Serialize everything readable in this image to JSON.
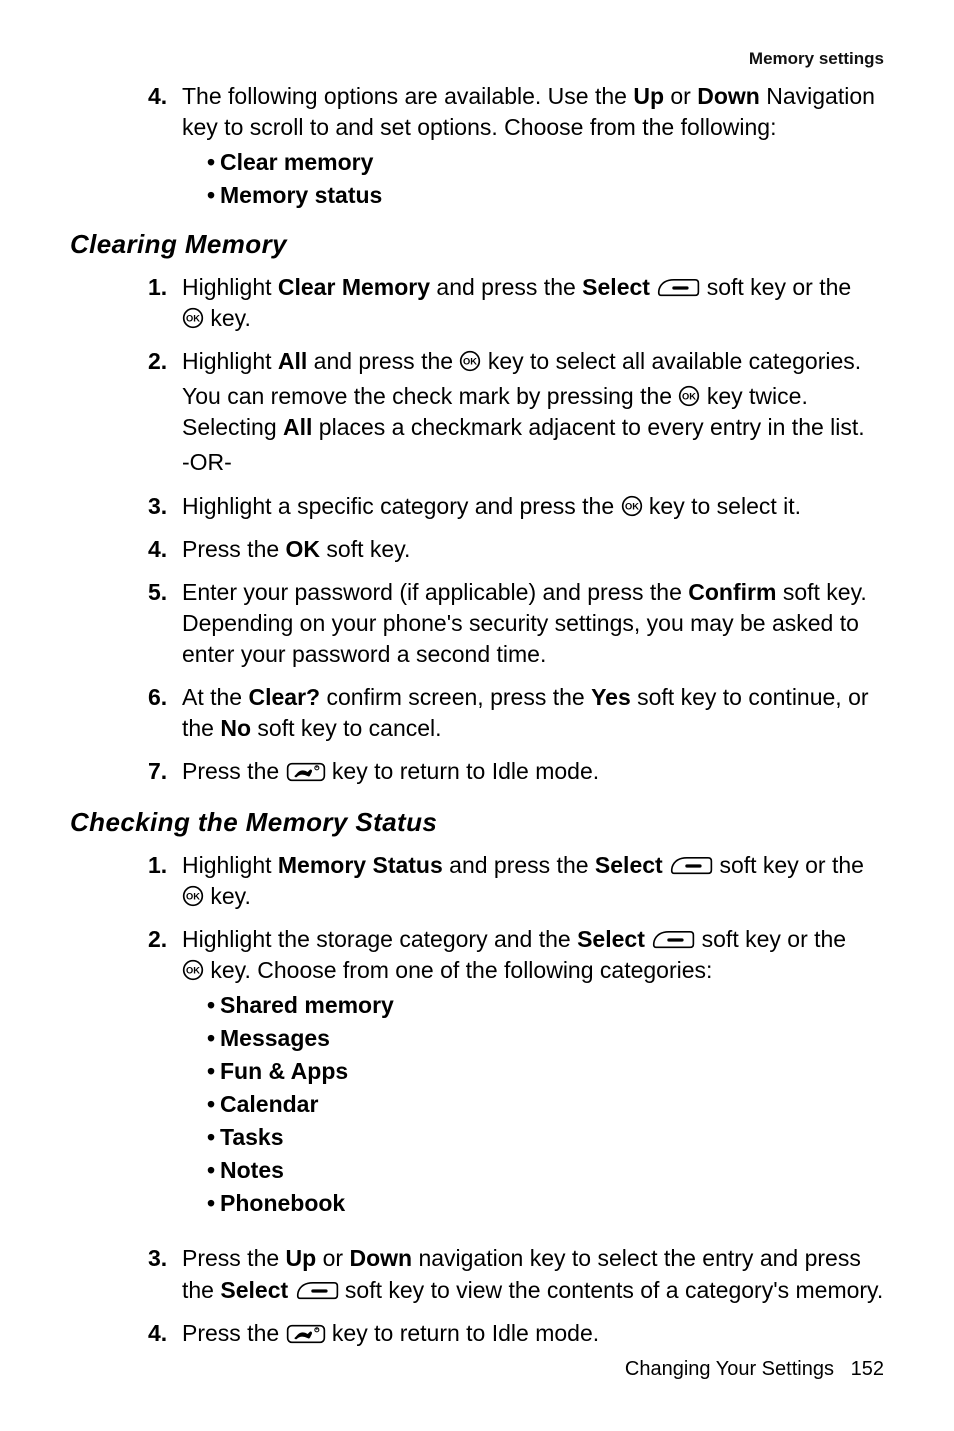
{
  "header": {
    "section_label": "Memory settings"
  },
  "block1": {
    "items": [
      {
        "n": "4.",
        "text_pre": "The following options are available. Use the ",
        "b1": "Up",
        "text_mid": " or ",
        "b2": "Down",
        "text_post": " Navigation key to scroll to and set options. Choose from the following:",
        "subs": [
          "Clear memory",
          "Memory status"
        ]
      }
    ]
  },
  "h2a": "Clearing Memory",
  "block2": {
    "items": [
      {
        "n": "1.",
        "pre": "Highlight ",
        "b1": "Clear Memory",
        "mid": " and press the ",
        "b2": "Select",
        "post1": " ",
        "post2": " soft key or the ",
        "post3": " key."
      },
      {
        "n": "2.",
        "l1_pre": "Highlight ",
        "l1_b": "All",
        "l1_mid": " and press the  ",
        "l1_post": " key to select all available categories.",
        "l2_pre": "You can remove the check mark by pressing the  ",
        "l2_mid": " key twice. Selecting ",
        "l2_b": "All",
        "l2_post": " places a checkmark adjacent to every entry in the list.",
        "l3": "-OR-"
      },
      {
        "n": "3.",
        "pre": "Highlight a specific category and press the  ",
        "post": " key to select it."
      },
      {
        "n": "4.",
        "pre": "Press the ",
        "b": "OK",
        "post": " soft key."
      },
      {
        "n": "5.",
        "pre": "Enter your password (if applicable) and press the ",
        "b": "Confirm",
        "post": " soft key. Depending on your phone's security settings, you may be asked to enter your password a second time."
      },
      {
        "n": "6.",
        "pre": "At the ",
        "b1": "Clear?",
        "mid": " confirm screen, press the ",
        "b2": "Yes",
        "mid2": " soft key to continue, or the ",
        "b3": "No",
        "post": " soft key to cancel."
      },
      {
        "n": "7.",
        "pre": "Press the ",
        "post": " key to return to Idle mode."
      }
    ]
  },
  "h2b": "Checking the Memory Status",
  "block3": {
    "items": [
      {
        "n": "1.",
        "pre": "Highlight ",
        "b1": "Memory Status",
        "mid": " and press the ",
        "b2": "Select",
        "post1": " ",
        "post2": " soft key or the ",
        "post3": " key."
      },
      {
        "n": "2.",
        "pre": "Highlight the storage category and the ",
        "b": "Select",
        "mid": " ",
        "post1": " soft key or the ",
        "post2": " key. Choose from one of the following categories:",
        "subs": [
          "Shared memory",
          "Messages",
          "Fun & Apps",
          "Calendar",
          "Tasks",
          "Notes",
          "Phonebook"
        ]
      },
      {
        "n": "3.",
        "pre": "Press the ",
        "b1": "Up",
        "mid": " or ",
        "b2": "Down",
        "mid2": " navigation key to select the entry and press the ",
        "b3": "Select",
        "post1": " ",
        "post2": " soft key to view the contents of a category's memory."
      },
      {
        "n": "4.",
        "pre": "Press the ",
        "post": " key to return to Idle mode."
      }
    ]
  },
  "footer": {
    "chapter": "Changing Your Settings",
    "page": "152"
  }
}
